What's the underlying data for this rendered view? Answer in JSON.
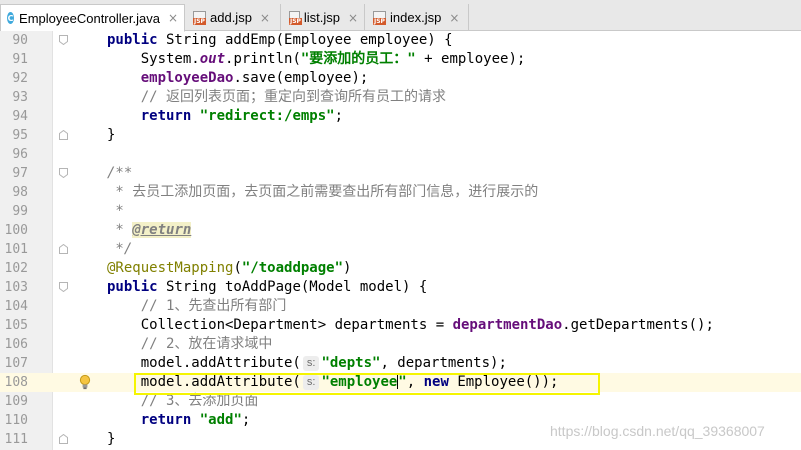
{
  "tabs": [
    {
      "label": "EmployeeController.java",
      "icon": "java-class-icon",
      "active": true
    },
    {
      "label": "add.jsp",
      "icon": "jsp-file-icon",
      "active": false
    },
    {
      "label": "list.jsp",
      "icon": "jsp-file-icon",
      "active": false
    },
    {
      "label": "index.jsp",
      "icon": "jsp-file-icon",
      "active": false
    }
  ],
  "tab_close_glyph": "×",
  "jsp_badge": "JSP",
  "class_badge": "C",
  "editor": {
    "current_line": 108,
    "lines": [
      {
        "n": "90"
      },
      {
        "n": "91"
      },
      {
        "n": "92"
      },
      {
        "n": "93"
      },
      {
        "n": "94"
      },
      {
        "n": "95"
      },
      {
        "n": "96"
      },
      {
        "n": "97"
      },
      {
        "n": "98"
      },
      {
        "n": "99"
      },
      {
        "n": "100"
      },
      {
        "n": "101"
      },
      {
        "n": "102"
      },
      {
        "n": "103"
      },
      {
        "n": "104"
      },
      {
        "n": "105"
      },
      {
        "n": "106"
      },
      {
        "n": "107"
      },
      {
        "n": "108"
      },
      {
        "n": "109"
      },
      {
        "n": "110"
      },
      {
        "n": "111"
      }
    ],
    "code": {
      "l90": {
        "kw1": "public",
        "t1": " String addEmp(Employee employee) {"
      },
      "l91": {
        "t1": "    System.",
        "st": "out",
        "t2": ".println(",
        "str": "\"要添加的员工：\"",
        "t3": " + employee);"
      },
      "l92": {
        "t1": "    ",
        "fld": "employeeDao",
        "t2": ".save(employee);"
      },
      "l93": {
        "t1": "    ",
        "cm": "// 返回列表页面；重定向到查询所有员工的请求"
      },
      "l94": {
        "t1": "    ",
        "kw": "return",
        "t2": " ",
        "str": "\"redirect:/emps\"",
        "t3": ";"
      },
      "l95": {
        "t1": "}"
      },
      "l97": {
        "cm": "/**"
      },
      "l98": {
        "cm": " * 去员工添加页面，去页面之前需要查出所有部门信息，进行展示的"
      },
      "l99": {
        "cm": " *"
      },
      "l100": {
        "cm": " * ",
        "tag": "@return"
      },
      "l101": {
        "cm": " */"
      },
      "l102": {
        "ann": "@RequestMapping",
        "t1": "(",
        "str": "\"/toaddpage\"",
        "t2": ")"
      },
      "l103": {
        "kw": "public",
        "t1": " String toAddPage(Model model) {"
      },
      "l104": {
        "t1": "    ",
        "cm": "// 1、先查出所有部门"
      },
      "l105": {
        "t1": "    Collection<Department> departments = ",
        "fld": "departmentDao",
        "t2": ".getDepartments();"
      },
      "l106": {
        "t1": "    ",
        "cm": "// 2、放在请求域中"
      },
      "l107": {
        "t1": "    model.addAttribute(",
        "hint": "s:",
        "str": "\"depts\"",
        "t2": ", departments);"
      },
      "l108": {
        "t1": "    model.addAttribute(",
        "hint": "s:",
        "str_a": "\"employee",
        "str_b": "\"",
        "t2": ", ",
        "kw": "new",
        "t3": " Employee());"
      },
      "l109": {
        "t1": "    ",
        "cm": "// 3、去添加页面"
      },
      "l110": {
        "t1": "    ",
        "kw": "return",
        "t2": " ",
        "str": "\"add\"",
        "t3": ";"
      },
      "l111": {
        "t1": "}"
      }
    }
  },
  "watermark": "https://blog.csdn.net/qq_39368007",
  "colors": {
    "keyword": "#000080",
    "string": "#008000",
    "comment": "#808080",
    "field": "#660e7a",
    "annotation": "#808000",
    "highlight_box": "#f5f500"
  }
}
